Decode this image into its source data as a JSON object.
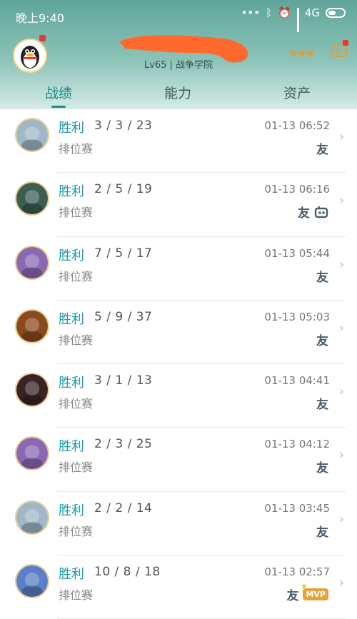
{
  "status_bar": {
    "time": "晚上9:40",
    "network": "4G",
    "icons": [
      "dots-icon",
      "bluetooth-icon",
      "alarm-icon",
      "signal-icon",
      "battery-icon"
    ]
  },
  "profile": {
    "level_text": "Lv65 | 战争学院"
  },
  "tabs": [
    {
      "label": "战绩",
      "active": true
    },
    {
      "label": "能力",
      "active": false
    },
    {
      "label": "资产",
      "active": false
    }
  ],
  "matches": [
    {
      "result": "胜利",
      "kda": "3 / 3 / 23",
      "mode": "排位赛",
      "time": "01-13 06:52",
      "tags": [
        "友"
      ],
      "hero_icon": "white-hair-hero",
      "hero_color": "#9fb7c6"
    },
    {
      "result": "胜利",
      "kda": "2 / 5 / 19",
      "mode": "排位赛",
      "time": "01-13 06:16",
      "tags": [
        "友",
        "team"
      ],
      "hero_icon": "green-mask-hero",
      "hero_color": "#3b5d52"
    },
    {
      "result": "胜利",
      "kda": "7 / 5 / 17",
      "mode": "排位赛",
      "time": "01-13 05:44",
      "tags": [
        "友"
      ],
      "hero_icon": "purple-hero",
      "hero_color": "#8a69b3"
    },
    {
      "result": "胜利",
      "kda": "5 / 9 / 37",
      "mode": "排位赛",
      "time": "01-13 05:03",
      "tags": [
        "友"
      ],
      "hero_icon": "orange-armor-hero",
      "hero_color": "#8b4a1e"
    },
    {
      "result": "胜利",
      "kda": "3 / 1 / 13",
      "mode": "排位赛",
      "time": "01-13 04:41",
      "tags": [
        "友"
      ],
      "hero_icon": "dark-red-hero",
      "hero_color": "#3a2324"
    },
    {
      "result": "胜利",
      "kda": "2 / 3 / 25",
      "mode": "排位赛",
      "time": "01-13 04:12",
      "tags": [
        "友"
      ],
      "hero_icon": "purple-hero",
      "hero_color": "#8a69b3"
    },
    {
      "result": "胜利",
      "kda": "2 / 2 / 14",
      "mode": "排位赛",
      "time": "01-13 03:45",
      "tags": [
        "友"
      ],
      "hero_icon": "white-hair-hero",
      "hero_color": "#9fb7c6"
    },
    {
      "result": "胜利",
      "kda": "10 / 8 / 18",
      "mode": "排位赛",
      "time": "01-13 02:57",
      "tags": [
        "友",
        "MVP"
      ],
      "hero_icon": "blue-yeti-hero",
      "hero_color": "#5b7fc8"
    }
  ],
  "colors": {
    "accent": "#1c8c88",
    "result": "#1e9aa8",
    "header_top": "#5fa59a",
    "mvp": "#e7a23a"
  }
}
